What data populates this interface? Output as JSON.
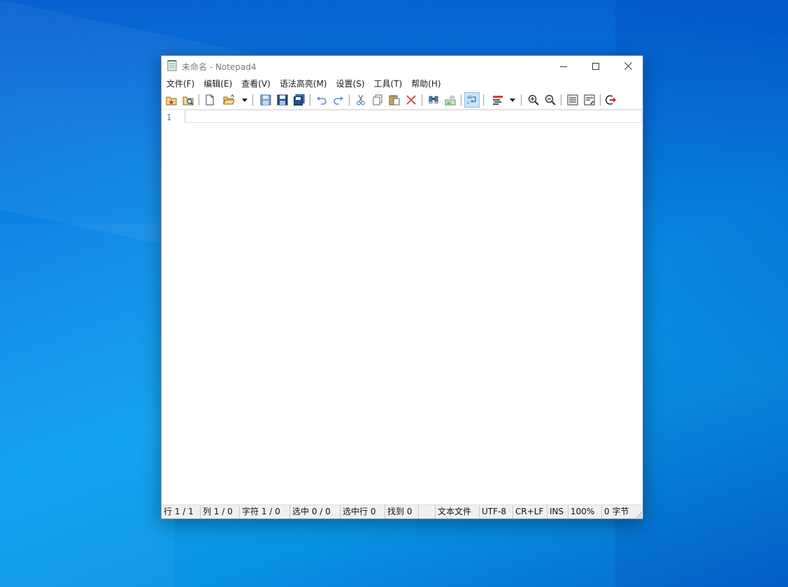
{
  "window": {
    "title": "未命名 - Notepad4"
  },
  "menu": {
    "items": [
      "文件(F)",
      "编辑(E)",
      "查看(V)",
      "语法高亮(M)",
      "设置(S)",
      "工具(T)",
      "帮助(H)"
    ]
  },
  "editor": {
    "line_number": "1"
  },
  "statusbar": {
    "items": [
      "行 1 / 1",
      "列 1 / 0",
      "字符 1 / 0",
      "选中 0 / 0",
      "选中行 0",
      "找到 0",
      "",
      "文本文件",
      "UTF-8",
      "CR+LF",
      "INS",
      "100%",
      "0 字节"
    ]
  },
  "colors": {
    "accent_blue": "#1f6fc5",
    "line_number": "#2b91af",
    "toolbar_red": "#d63b3b",
    "toolbar_active": "#cce4f7"
  },
  "icons": {
    "toolbar": [
      "favorites-icon",
      "browse-icon",
      "new-file-icon",
      "open-file-icon",
      "save-icon",
      "save-as-icon",
      "save-copy-icon",
      "undo-icon",
      "redo-icon",
      "cut-icon",
      "copy-icon",
      "paste-icon",
      "delete-icon",
      "find-icon",
      "replace-icon",
      "word-wrap-icon",
      "scheme-icon",
      "zoom-in-icon",
      "zoom-out-icon",
      "view-icon",
      "customize-icon",
      "exit-icon"
    ]
  }
}
